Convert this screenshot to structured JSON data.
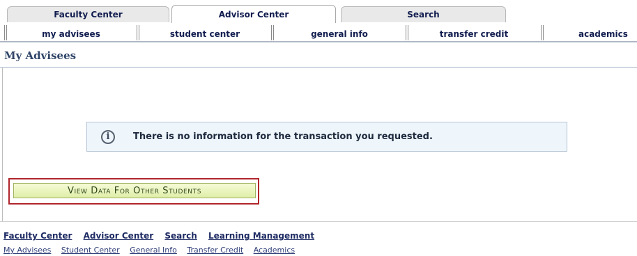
{
  "top_tabs": [
    {
      "label": "Faculty Center",
      "active": false
    },
    {
      "label": "Advisor Center",
      "active": true
    },
    {
      "label": "Search",
      "active": false
    }
  ],
  "sub_tabs": [
    {
      "label": "my advisees",
      "active": true
    },
    {
      "label": "student center"
    },
    {
      "label": "general info"
    },
    {
      "label": "transfer credit"
    },
    {
      "label": "academics"
    }
  ],
  "page": {
    "title": "My Advisees",
    "info_message": "There is no information for the transaction you requested.",
    "info_icon": "info-icon",
    "view_button_label": "View Data For Other Students"
  },
  "footer": {
    "primary_links": [
      "Faculty Center",
      "Advisor Center",
      "Search",
      "Learning Management"
    ],
    "secondary_links": [
      "My Advisees",
      "Student Center",
      "General Info",
      "Transfer Credit",
      "Academics"
    ]
  },
  "colors": {
    "highlight_border": "#b1252c",
    "button_bg": "#e9f4c0",
    "nav_text": "#111d4f",
    "info_bg": "#eef5fb"
  }
}
